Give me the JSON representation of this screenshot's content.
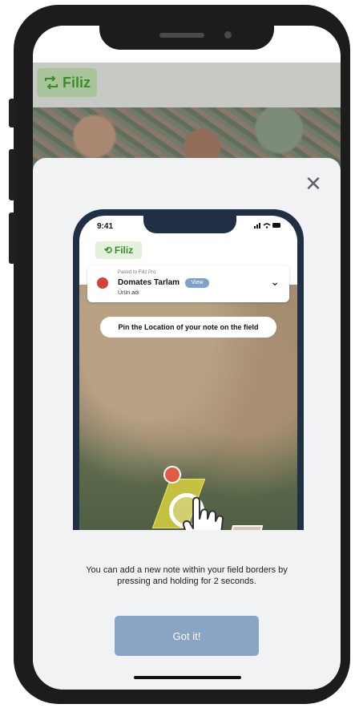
{
  "app": {
    "name": "Filiz",
    "logo_icon": "filiz-arrows-icon"
  },
  "modal": {
    "close_icon": "close-icon",
    "message": "You can add a new note within your field borders by pressing and holding for 2 seconds.",
    "button_label": "Got it!"
  },
  "illustration": {
    "status_time": "9:41",
    "logo_text": "Filiz",
    "field_card": {
      "paired_text": "Paired to Filiz Pro",
      "field_name": "Domates Tarlam",
      "view_badge": "View",
      "product_text": "Ürün adı"
    },
    "pin_banner": "Pin the Location of your note on the field"
  },
  "colors": {
    "accent_green": "#3f8a2e",
    "button_blue": "#8aa4c6",
    "sheet_bg": "#f1f2f4",
    "pin_red": "#e05b45"
  }
}
